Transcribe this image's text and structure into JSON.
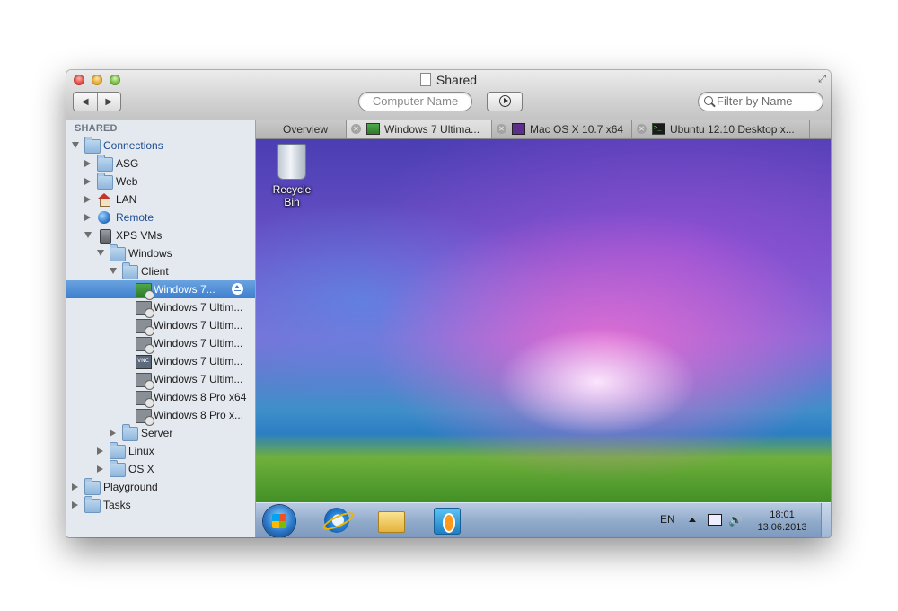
{
  "window": {
    "title": "Shared",
    "nav_back": "◀",
    "nav_forward": "▶",
    "computer_name_placeholder": "Computer Name",
    "filter_placeholder": "Filter by Name",
    "fullscreen_glyph": "⤢"
  },
  "sidebar": {
    "header": "SHARED",
    "items": [
      {
        "label": "Connections"
      },
      {
        "label": "ASG"
      },
      {
        "label": "Web"
      },
      {
        "label": "LAN"
      },
      {
        "label": "Remote"
      },
      {
        "label": "XPS VMs"
      },
      {
        "label": "Windows"
      },
      {
        "label": "Client"
      },
      {
        "label": "Windows 7..."
      },
      {
        "label": "Windows 7 Ultim..."
      },
      {
        "label": "Windows 7 Ultim..."
      },
      {
        "label": "Windows 7 Ultim..."
      },
      {
        "label": "Windows 7 Ultim..."
      },
      {
        "label": "Windows 7 Ultim..."
      },
      {
        "label": "Windows 8 Pro x64"
      },
      {
        "label": "Windows 8 Pro x..."
      },
      {
        "label": "Server"
      },
      {
        "label": "Linux"
      },
      {
        "label": "OS X"
      },
      {
        "label": "Playground"
      },
      {
        "label": "Tasks"
      }
    ],
    "footer": {
      "add": "+▾",
      "action": "✻▾",
      "view": "▦▾"
    }
  },
  "tabs": [
    {
      "label": "Overview"
    },
    {
      "label": "Windows 7 Ultima..."
    },
    {
      "label": "Mac OS X 10.7 x64"
    },
    {
      "label": "Ubuntu 12.10 Desktop x..."
    }
  ],
  "tab_close_glyph": "✕",
  "desktop": {
    "recycle_bin_label": "Recycle Bin",
    "tray_language": "EN",
    "tray_volume": "🔊",
    "clock_time": "18:01",
    "clock_date": "13.06.2013"
  },
  "colors": {
    "selection": "#3d7fcf",
    "blue_label": "#1e4c94"
  }
}
